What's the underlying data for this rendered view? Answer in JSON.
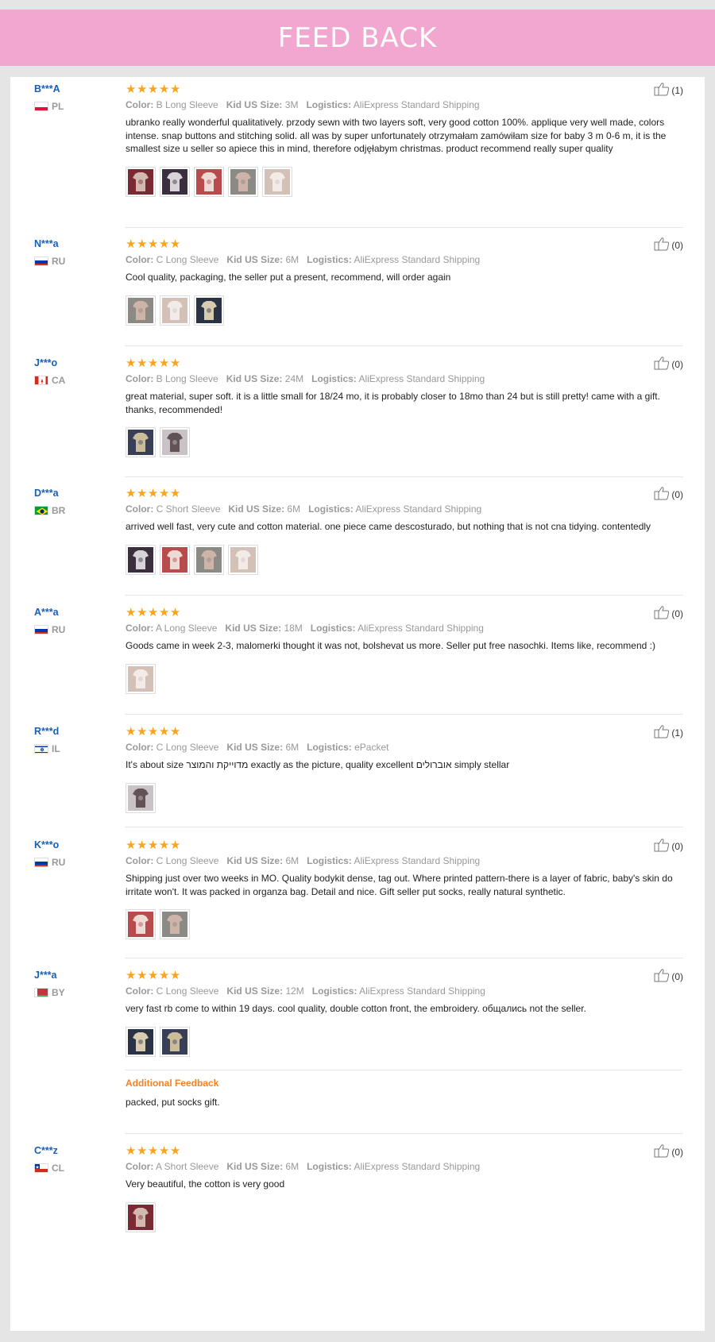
{
  "banner": {
    "title": "FEED BACK"
  },
  "labels": {
    "color": "Color:",
    "size": "Kid US Size:",
    "logistics": "Logistics:"
  },
  "colors": {
    "banner": "#f2a7d0",
    "star": "#f7a521",
    "username": "#1a5fb4",
    "additional": "#f58220"
  },
  "reviews": [
    {
      "user": "B***A",
      "country": "PL",
      "color": "B Long Sleeve",
      "size": "3M",
      "logistics": "AliExpress Standard Shipping",
      "text": "ubranko really wonderful qualitatively. przody sewn with two layers soft, very good cotton 100%. applique very well made, colors intense. snap buttons and stitching solid. all was by super unfortunately otrzymałam zamówiłam size for baby 3 m 0-6 m, it is the smallest size u seller so apiece this in mind, therefore odjęłabym christmas. product recommend really super quality",
      "likes": "(1)",
      "thumbs": 5
    },
    {
      "user": "N***a",
      "country": "RU",
      "color": "C Long Sleeve",
      "size": "6M",
      "logistics": "AliExpress Standard Shipping",
      "text": "Cool quality, packaging, the seller put a present, recommend, will order again",
      "likes": "(0)",
      "thumbs": 3
    },
    {
      "user": "J***o",
      "country": "CA",
      "color": "B Long Sleeve",
      "size": "24M",
      "logistics": "AliExpress Standard Shipping",
      "text": "great material, super soft. it is a little small for 18/24 mo, it is probably closer to 18mo than 24 but is still pretty! came with a gift. thanks, recommended!",
      "likes": "(0)",
      "thumbs": 2
    },
    {
      "user": "D***a",
      "country": "BR",
      "color": "C Short Sleeve",
      "size": "6M",
      "logistics": "AliExpress Standard Shipping",
      "text": "arrived well fast, very cute and cotton material. one piece came descosturado, but nothing that is not cna tidying. contentedly",
      "likes": "(0)",
      "thumbs": 4
    },
    {
      "user": "A***a",
      "country": "RU",
      "color": "A Long Sleeve",
      "size": "18M",
      "logistics": "AliExpress Standard Shipping",
      "text": "Goods came in week 2-3, malomerki thought it was not, bolshevat us more. Seller put free nasochki. Items like, recommend :)",
      "likes": "(0)",
      "thumbs": 1
    },
    {
      "user": "R***d",
      "country": "IL",
      "color": "C Long Sleeve",
      "size": "6M",
      "logistics": "ePacket",
      "text": "It's about size מדוייקת והמוצר exactly as the picture, quality excellent אוברולים simply stellar",
      "likes": "(1)",
      "thumbs": 1
    },
    {
      "user": "K***o",
      "country": "RU",
      "color": "C Long Sleeve",
      "size": "6M",
      "logistics": "AliExpress Standard Shipping",
      "text": "Shipping just over two weeks in MO. Quality bodykit dense, tag out. Where printed pattern-there is a layer of fabric, baby's skin do irritate won't. It was packed in organza bag. Detail and nice. Gift seller put socks, really natural synthetic.",
      "likes": "(0)",
      "thumbs": 2
    },
    {
      "user": "J***a",
      "country": "BY",
      "color": "C Long Sleeve",
      "size": "12M",
      "logistics": "AliExpress Standard Shipping",
      "text": "very fast rb come to within 19 days. cool quality, double cotton front, the embroidery. общались not the seller.",
      "likes": "(0)",
      "thumbs": 2,
      "additional_label": "Additional Feedback",
      "additional_text": "packed, put socks gift."
    },
    {
      "user": "C***z",
      "country": "CL",
      "color": "A Short Sleeve",
      "size": "6M",
      "logistics": "AliExpress Standard Shipping",
      "text": "Very beautiful, the cotton is very good",
      "likes": "(0)",
      "thumbs": 1
    }
  ]
}
